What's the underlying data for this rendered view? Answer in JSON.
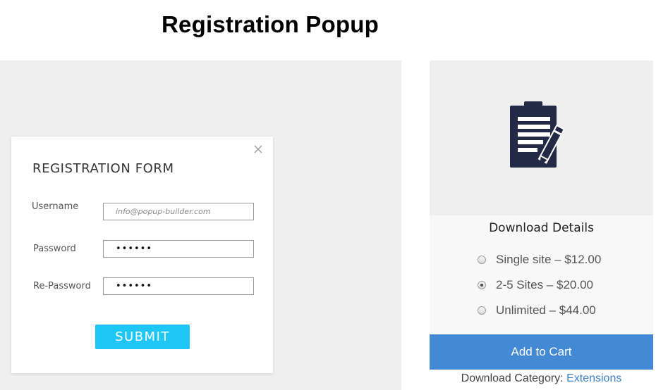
{
  "page": {
    "title": "Registration Popup"
  },
  "popup": {
    "heading": "REGISTRATION FORM",
    "close_icon": "close-icon",
    "fields": [
      {
        "label": "Username",
        "placeholder": "info@popup-builder.com",
        "value": ""
      },
      {
        "label": "Password",
        "placeholder": "",
        "value": "••••••"
      },
      {
        "label": "Re-Password",
        "placeholder": "",
        "value": "••••••"
      }
    ],
    "submit_label": "SUBMIT"
  },
  "product": {
    "image_icon": "clipboard-pencil-icon",
    "details_title": "Download Details",
    "price_options": [
      {
        "label": "Single site – $12.00",
        "selected": false
      },
      {
        "label": "2-5 Sites – $20.00",
        "selected": true
      },
      {
        "label": "Unlimited – $44.00",
        "selected": false
      }
    ],
    "add_to_cart_label": "Add to Cart",
    "category_prefix": "Download Category:",
    "category_link": "Extensions"
  },
  "colors": {
    "submit": "#1ec6f5",
    "add_to_cart": "#4489d4",
    "icon": "#232a45",
    "link": "#3f82c8"
  }
}
